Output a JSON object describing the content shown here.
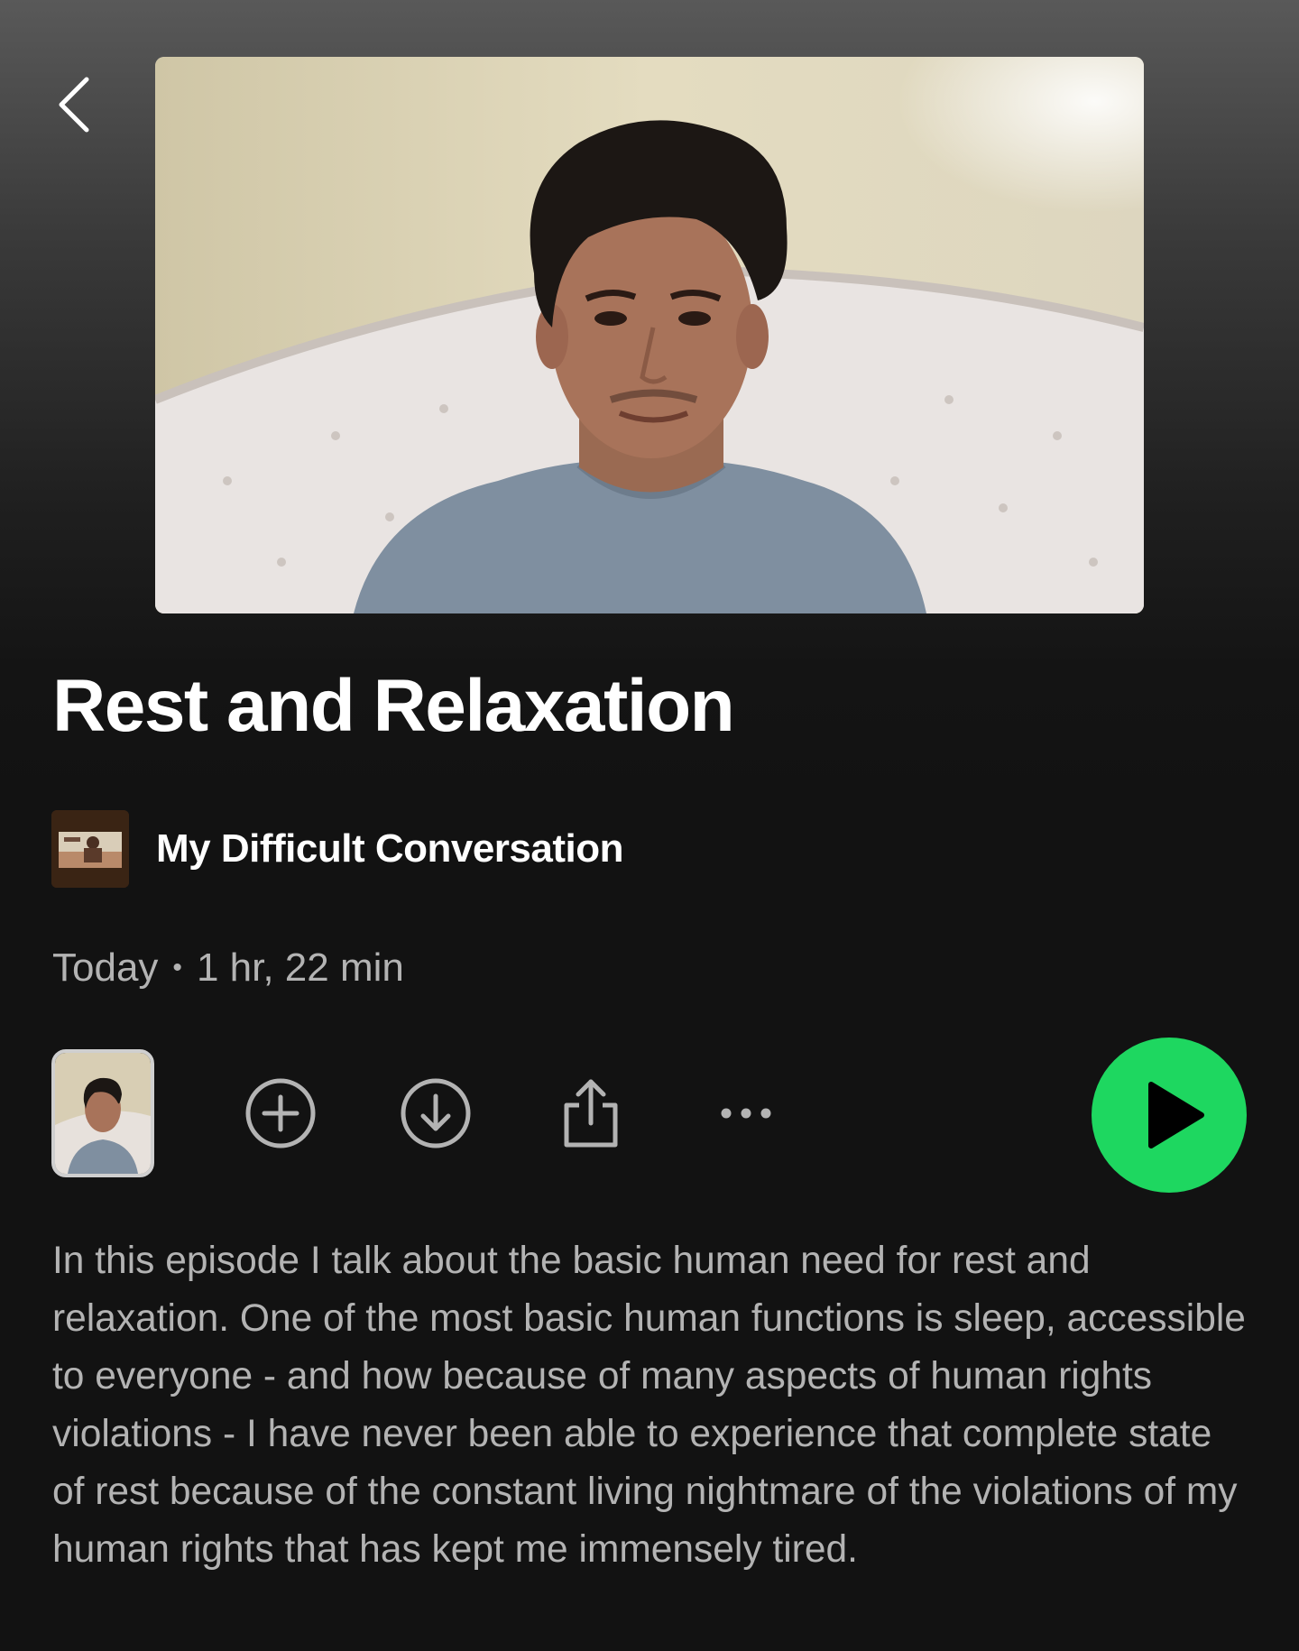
{
  "episode": {
    "title": "Rest and Relaxation",
    "show_name": "My Difficult Conversation",
    "date": "Today",
    "separator": "•",
    "duration": "1 hr, 22 min",
    "description": "In this episode I talk about the basic human need for rest and relaxation. One of the most basic human functions is sleep, accessible to everyone - and how because of many aspects of human rights violations - I have never been able to experience that complete state of rest because of the constant living nightmare of the violations of my human rights that has kept me immensely tired."
  },
  "icons": {
    "back": "chevron-left-icon",
    "add": "plus-circle-icon",
    "download": "download-circle-icon",
    "share": "share-icon",
    "more": "more-horizontal-icon",
    "play": "play-icon"
  },
  "colors": {
    "accent": "#1ed760",
    "background": "#121212",
    "text_primary": "#ffffff",
    "text_secondary": "#b3b3b3"
  }
}
